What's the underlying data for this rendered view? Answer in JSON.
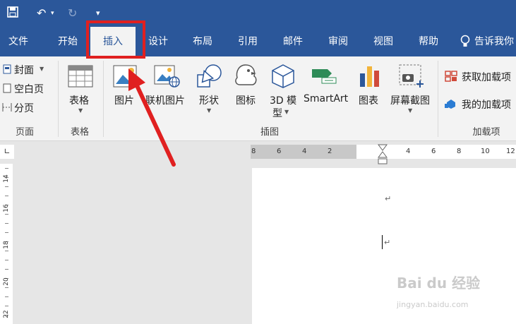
{
  "titlebar": {
    "undo_icon": "undo-icon",
    "redo_icon": "redo-icon"
  },
  "menu": {
    "tabs": [
      "文件",
      "开始",
      "插入",
      "设计",
      "布局",
      "引用",
      "邮件",
      "审阅",
      "视图",
      "帮助"
    ],
    "active_tab": "插入",
    "tell_me": "告诉我你"
  },
  "ribbon": {
    "pages": {
      "cover": "封面",
      "blank": "空白页",
      "page_break": "分页",
      "group": "页面"
    },
    "tables": {
      "table": "表格",
      "group": "表格"
    },
    "illustrations": {
      "picture": "图片",
      "online_picture": "联机图片",
      "shapes": "形状",
      "icons": "图标",
      "model3d_line1": "3D 模",
      "model3d_line2": "型",
      "smartart": "SmartArt",
      "chart": "图表",
      "screenshot": "屏幕截图",
      "group": "插图"
    },
    "addins": {
      "get": "获取加载项",
      "mine": "我的加载项",
      "group": "加载项"
    }
  },
  "ruler": {
    "left_numbers": [
      "8",
      "6",
      "4",
      "2"
    ],
    "right_numbers": [
      "4",
      "6",
      "8",
      "10",
      "12"
    ],
    "vertical_numbers": [
      "14",
      "16",
      "18",
      "20",
      "22"
    ]
  },
  "document": {
    "para_mark": "↵"
  },
  "watermark": {
    "line1": "Bai du 经验",
    "line2": "jingyan.baidu.com"
  },
  "colors": {
    "accent": "#2b579a",
    "highlight": "#e02020",
    "ribbon_bg": "#f3f3f3"
  }
}
